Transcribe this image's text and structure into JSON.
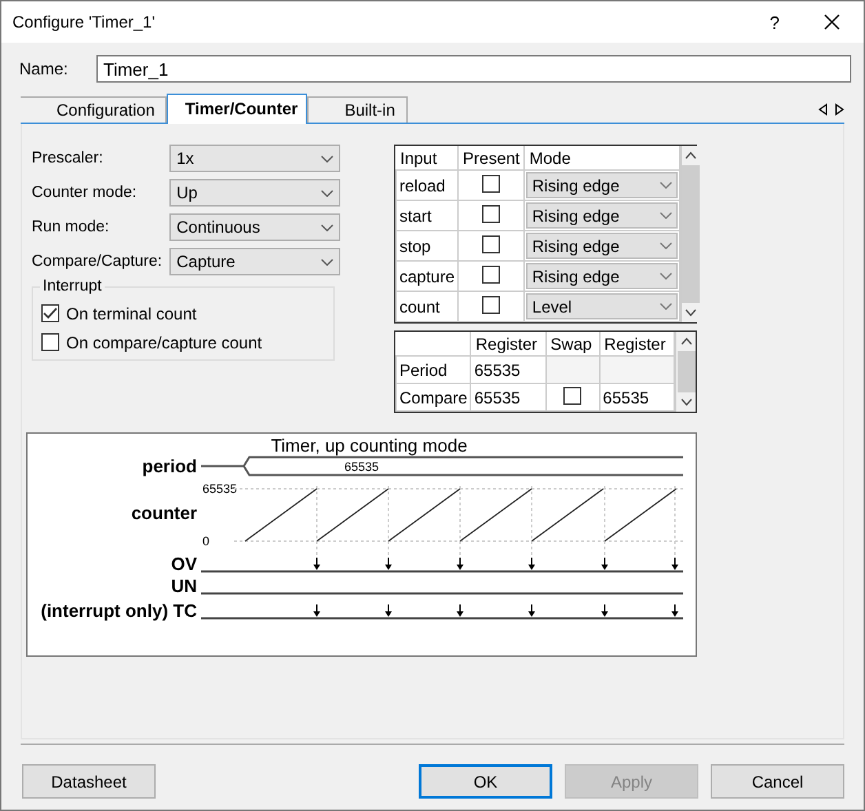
{
  "window": {
    "title": "Configure 'Timer_1'",
    "help": "?"
  },
  "name_field": {
    "label": "Name:",
    "value": "Timer_1"
  },
  "tabs": [
    {
      "label": "Configuration",
      "selected": false
    },
    {
      "label": "Timer/Counter",
      "selected": true
    },
    {
      "label": "Built-in",
      "selected": false
    }
  ],
  "settings": [
    {
      "label": "Prescaler:",
      "value": "1x"
    },
    {
      "label": "Counter mode:",
      "value": "Up"
    },
    {
      "label": "Run mode:",
      "value": "Continuous"
    },
    {
      "label": "Compare/Capture:",
      "value": "Capture"
    }
  ],
  "interrupt": {
    "title": "Interrupt",
    "options": [
      {
        "label": "On terminal count",
        "checked": true
      },
      {
        "label": "On compare/capture count",
        "checked": false
      }
    ]
  },
  "inputs_table": {
    "columns": [
      "Input",
      "Present",
      "Mode"
    ],
    "rows": [
      {
        "input": "reload",
        "present": false,
        "mode": "Rising edge"
      },
      {
        "input": "start",
        "present": false,
        "mode": "Rising edge"
      },
      {
        "input": "stop",
        "present": false,
        "mode": "Rising edge"
      },
      {
        "input": "capture",
        "present": false,
        "mode": "Rising edge"
      },
      {
        "input": "count",
        "present": false,
        "mode": "Level"
      }
    ]
  },
  "register_table": {
    "columns": [
      "",
      "Register",
      "Swap",
      "Register"
    ],
    "rows": [
      {
        "name": "Period",
        "register": "65535",
        "swap": null,
        "register_b": ""
      },
      {
        "name": "Compare",
        "register": "65535",
        "swap": false,
        "register_b": "65535"
      }
    ]
  },
  "diagram": {
    "title": "Timer, up counting mode",
    "period_label": "period",
    "period_value": "65535",
    "counter_label": "counter",
    "counter_max": "65535",
    "counter_min": "0",
    "signals": [
      {
        "label": "OV",
        "pulses": true
      },
      {
        "label": "UN",
        "pulses": false
      },
      {
        "label": "(interrupt only) TC",
        "pulses": true
      }
    ]
  },
  "buttons": [
    {
      "label": "Datasheet",
      "kind": "normal"
    },
    {
      "label": "OK",
      "kind": "default"
    },
    {
      "label": "Apply",
      "kind": "disabled"
    },
    {
      "label": "Cancel",
      "kind": "normal"
    }
  ]
}
